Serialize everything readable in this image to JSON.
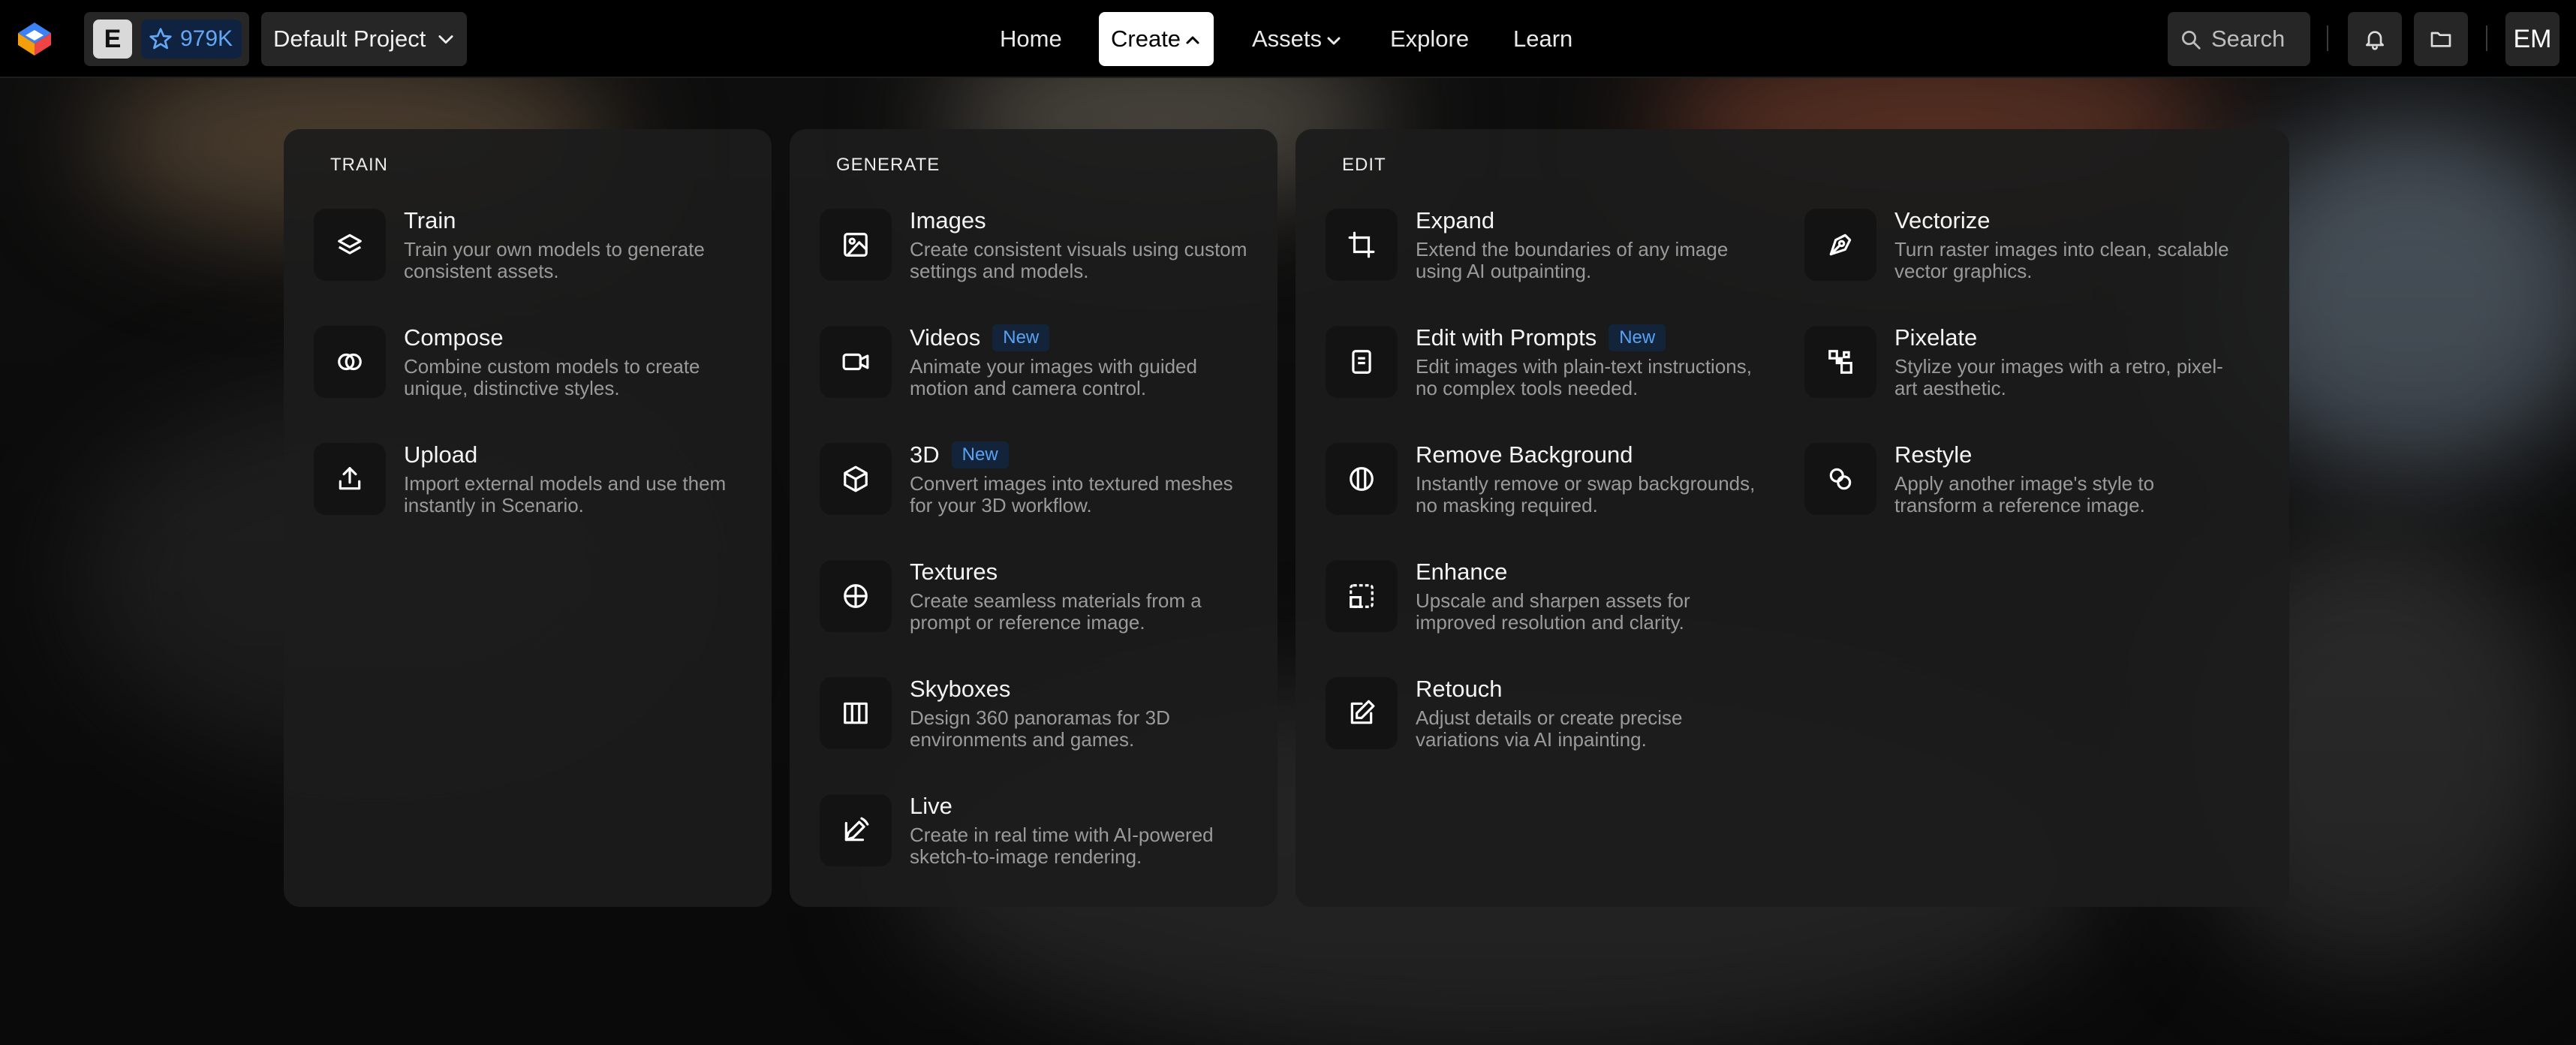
{
  "topbar": {
    "workspace_letter": "E",
    "credits": "979K",
    "project": "Default Project",
    "nav": {
      "home": "Home",
      "create": "Create",
      "assets": "Assets",
      "explore": "Explore",
      "learn": "Learn"
    },
    "search_label": "Search",
    "avatar_initials": "EM"
  },
  "menu": {
    "train": {
      "title": "TRAIN",
      "items": [
        {
          "title": "Train",
          "desc": "Train your own models to generate consistent assets."
        },
        {
          "title": "Compose",
          "desc": "Combine custom models to create unique, distinctive styles."
        },
        {
          "title": "Upload",
          "desc": "Import external models and use them instantly in Scenario."
        }
      ]
    },
    "generate": {
      "title": "GENERATE",
      "items": [
        {
          "title": "Images",
          "desc": "Create consistent visuals using custom settings and models."
        },
        {
          "title": "Videos",
          "badge": "New",
          "desc": "Animate your images with guided motion and camera control."
        },
        {
          "title": "3D",
          "badge": "New",
          "desc": "Convert images into textured meshes for your 3D workflow."
        },
        {
          "title": "Textures",
          "desc": "Create seamless materials from a prompt or reference image."
        },
        {
          "title": "Skyboxes",
          "desc": "Design 360 panoramas for 3D environments and games."
        },
        {
          "title": "Live",
          "desc": "Create in real time with AI-powered sketch-to-image rendering."
        }
      ]
    },
    "edit": {
      "title": "EDIT",
      "items": [
        {
          "title": "Expand",
          "desc": "Extend the boundaries of any image using AI outpainting."
        },
        {
          "title": "Edit with Prompts",
          "badge": "New",
          "desc": "Edit images with plain-text instructions, no complex tools needed."
        },
        {
          "title": "Remove Background",
          "desc": "Instantly remove or swap backgrounds, no masking required."
        },
        {
          "title": "Enhance",
          "desc": "Upscale and sharpen assets for improved resolution and clarity."
        },
        {
          "title": "Retouch",
          "desc": "Adjust details or create precise variations via AI inpainting."
        },
        {
          "title": "Vectorize",
          "desc": "Turn raster images into clean, scalable vector graphics."
        },
        {
          "title": "Pixelate",
          "desc": "Stylize your images with a retro, pixel-art aesthetic."
        },
        {
          "title": "Restyle",
          "desc": "Apply another image's style to transform a reference image."
        }
      ]
    }
  },
  "colors": {
    "accent_blue": "#5aa2f4",
    "badge_bg": "#13243a",
    "panel_bg": "#1c1c1c",
    "topbar_bg": "#000000"
  }
}
